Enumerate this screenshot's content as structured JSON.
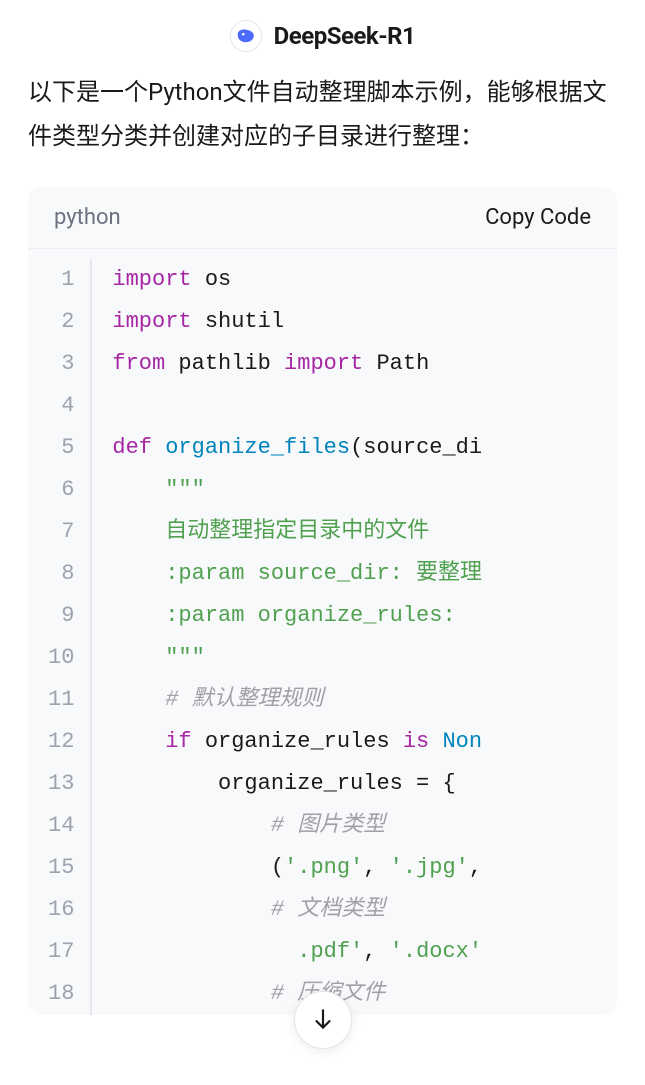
{
  "header": {
    "title": "DeepSeek-R1"
  },
  "description": "以下是一个Python文件自动整理脚本示例，能够根据文件类型分类并创建对应的子目录进行整理：",
  "code": {
    "lang": "python",
    "copy_label": "Copy Code",
    "lines": [
      {
        "n": 1,
        "tokens": [
          [
            "kw",
            "import"
          ],
          [
            "",
            " os"
          ]
        ]
      },
      {
        "n": 2,
        "tokens": [
          [
            "kw",
            "import"
          ],
          [
            "",
            " shutil"
          ]
        ]
      },
      {
        "n": 3,
        "tokens": [
          [
            "kw",
            "from"
          ],
          [
            "",
            " pathlib "
          ],
          [
            "kw",
            "import"
          ],
          [
            "",
            " Path"
          ]
        ]
      },
      {
        "n": 4,
        "tokens": []
      },
      {
        "n": 5,
        "tokens": [
          [
            "kw",
            "def"
          ],
          [
            "",
            " "
          ],
          [
            "fn",
            "organize_files"
          ],
          [
            "",
            "(source_di"
          ]
        ]
      },
      {
        "n": 6,
        "tokens": [
          [
            "",
            "    "
          ],
          [
            "str",
            "\"\"\""
          ]
        ]
      },
      {
        "n": 7,
        "tokens": [
          [
            "",
            "    "
          ],
          [
            "str",
            "自动整理指定目录中的文件"
          ]
        ]
      },
      {
        "n": 8,
        "tokens": [
          [
            "",
            "    "
          ],
          [
            "str",
            ":param source_dir: 要整理"
          ]
        ]
      },
      {
        "n": 9,
        "tokens": [
          [
            "",
            "    "
          ],
          [
            "str",
            ":param organize_rules: "
          ]
        ]
      },
      {
        "n": 10,
        "tokens": [
          [
            "",
            "    "
          ],
          [
            "str",
            "\"\"\""
          ]
        ]
      },
      {
        "n": 11,
        "tokens": [
          [
            "",
            "    "
          ],
          [
            "cmt",
            "# 默认整理规则"
          ]
        ]
      },
      {
        "n": 12,
        "tokens": [
          [
            "",
            "    "
          ],
          [
            "kw",
            "if"
          ],
          [
            "",
            " organize_rules "
          ],
          [
            "kw",
            "is"
          ],
          [
            "",
            " "
          ],
          [
            "const",
            "Non"
          ]
        ]
      },
      {
        "n": 13,
        "tokens": [
          [
            "",
            "        organize_rules = {"
          ]
        ]
      },
      {
        "n": 14,
        "tokens": [
          [
            "",
            "            "
          ],
          [
            "cmt",
            "# 图片类型"
          ]
        ]
      },
      {
        "n": 15,
        "tokens": [
          [
            "",
            "            ("
          ],
          [
            "str",
            "'.png'"
          ],
          [
            "",
            ", "
          ],
          [
            "str",
            "'.jpg'"
          ],
          [
            "",
            ","
          ]
        ]
      },
      {
        "n": 16,
        "tokens": [
          [
            "",
            "            "
          ],
          [
            "cmt",
            "# 文档类型"
          ]
        ]
      },
      {
        "n": 17,
        "tokens": [
          [
            "",
            "              "
          ],
          [
            "str",
            ".pdf'"
          ],
          [
            "",
            ", "
          ],
          [
            "str",
            "'.docx'"
          ]
        ]
      },
      {
        "n": 18,
        "tokens": [
          [
            "",
            "            "
          ],
          [
            "cmt",
            "# 压缩文件"
          ]
        ]
      }
    ]
  }
}
